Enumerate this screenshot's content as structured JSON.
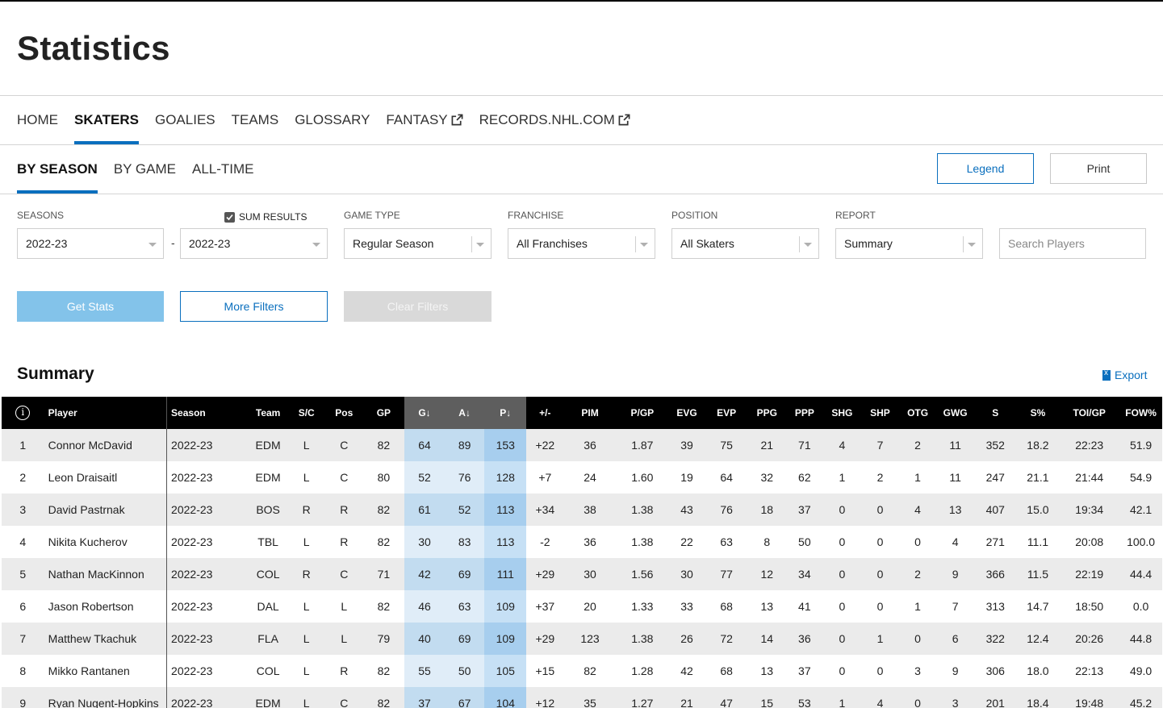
{
  "page_title": "Statistics",
  "nav": [
    {
      "label": "HOME",
      "active": false,
      "external": false
    },
    {
      "label": "SKATERS",
      "active": true,
      "external": false
    },
    {
      "label": "GOALIES",
      "active": false,
      "external": false
    },
    {
      "label": "TEAMS",
      "active": false,
      "external": false
    },
    {
      "label": "GLOSSARY",
      "active": false,
      "external": false
    },
    {
      "label": "FANTASY",
      "active": false,
      "external": true
    },
    {
      "label": "RECORDS.NHL.COM",
      "active": false,
      "external": true
    }
  ],
  "subnav": [
    {
      "label": "BY SEASON",
      "active": true
    },
    {
      "label": "BY GAME",
      "active": false
    },
    {
      "label": "ALL-TIME",
      "active": false
    }
  ],
  "buttons": {
    "legend": "Legend",
    "print": "Print",
    "get_stats": "Get Stats",
    "more_filters": "More Filters",
    "clear_filters": "Clear Filters"
  },
  "filters": {
    "seasons_label": "SEASONS",
    "season_from": "2022-23",
    "season_dash": "-",
    "season_to": "2022-23",
    "sum_results_label": "SUM RESULTS",
    "sum_results_checked": true,
    "game_type_label": "GAME TYPE",
    "game_type": "Regular Season",
    "franchise_label": "FRANCHISE",
    "franchise": "All Franchises",
    "position_label": "POSITION",
    "position": "All Skaters",
    "report_label": "REPORT",
    "report": "Summary",
    "search_placeholder": "Search Players"
  },
  "section_title": "Summary",
  "export_label": "Export",
  "colors": {
    "accent": "#0a6fbe",
    "get_stats_bg": "#83c3ea",
    "positive": "#3d9a3d",
    "negative": "#d63333"
  },
  "table": {
    "columns": [
      "",
      "Player",
      "Season",
      "Team",
      "S/C",
      "Pos",
      "GP",
      "G↓",
      "A↓",
      "P↓",
      "+/-",
      "PIM",
      "P/GP",
      "EVG",
      "EVP",
      "PPG",
      "PPP",
      "SHG",
      "SHP",
      "OTG",
      "GWG",
      "S",
      "S%",
      "TOI/GP",
      "FOW%"
    ],
    "rows": [
      [
        "1",
        "Connor McDavid",
        "2022-23",
        "EDM",
        "L",
        "C",
        "82",
        "64",
        "89",
        "153",
        "+22",
        "36",
        "1.87",
        "39",
        "75",
        "21",
        "71",
        "4",
        "7",
        "2",
        "11",
        "352",
        "18.2",
        "22:23",
        "51.9"
      ],
      [
        "2",
        "Leon Draisaitl",
        "2022-23",
        "EDM",
        "L",
        "C",
        "80",
        "52",
        "76",
        "128",
        "+7",
        "24",
        "1.60",
        "19",
        "64",
        "32",
        "62",
        "1",
        "2",
        "1",
        "11",
        "247",
        "21.1",
        "21:44",
        "54.9"
      ],
      [
        "3",
        "David Pastrnak",
        "2022-23",
        "BOS",
        "R",
        "R",
        "82",
        "61",
        "52",
        "113",
        "+34",
        "38",
        "1.38",
        "43",
        "76",
        "18",
        "37",
        "0",
        "0",
        "4",
        "13",
        "407",
        "15.0",
        "19:34",
        "42.1"
      ],
      [
        "4",
        "Nikita Kucherov",
        "2022-23",
        "TBL",
        "L",
        "R",
        "82",
        "30",
        "83",
        "113",
        "-2",
        "36",
        "1.38",
        "22",
        "63",
        "8",
        "50",
        "0",
        "0",
        "0",
        "4",
        "271",
        "11.1",
        "20:08",
        "100.0"
      ],
      [
        "5",
        "Nathan MacKinnon",
        "2022-23",
        "COL",
        "R",
        "C",
        "71",
        "42",
        "69",
        "111",
        "+29",
        "30",
        "1.56",
        "30",
        "77",
        "12",
        "34",
        "0",
        "0",
        "2",
        "9",
        "366",
        "11.5",
        "22:19",
        "44.4"
      ],
      [
        "6",
        "Jason Robertson",
        "2022-23",
        "DAL",
        "L",
        "L",
        "82",
        "46",
        "63",
        "109",
        "+37",
        "20",
        "1.33",
        "33",
        "68",
        "13",
        "41",
        "0",
        "0",
        "1",
        "7",
        "313",
        "14.7",
        "18:50",
        "0.0"
      ],
      [
        "7",
        "Matthew Tkachuk",
        "2022-23",
        "FLA",
        "L",
        "L",
        "79",
        "40",
        "69",
        "109",
        "+29",
        "123",
        "1.38",
        "26",
        "72",
        "14",
        "36",
        "0",
        "1",
        "0",
        "6",
        "322",
        "12.4",
        "20:26",
        "44.8"
      ],
      [
        "8",
        "Mikko Rantanen",
        "2022-23",
        "COL",
        "L",
        "R",
        "82",
        "55",
        "50",
        "105",
        "+15",
        "82",
        "1.28",
        "42",
        "68",
        "13",
        "37",
        "0",
        "0",
        "3",
        "9",
        "306",
        "18.0",
        "22:13",
        "49.0"
      ],
      [
        "9",
        "Ryan Nugent-Hopkins",
        "2022-23",
        "EDM",
        "L",
        "C",
        "82",
        "37",
        "67",
        "104",
        "+12",
        "35",
        "1.27",
        "21",
        "47",
        "15",
        "53",
        "1",
        "4",
        "0",
        "3",
        "201",
        "18.4",
        "19:48",
        "45.2"
      ]
    ]
  }
}
